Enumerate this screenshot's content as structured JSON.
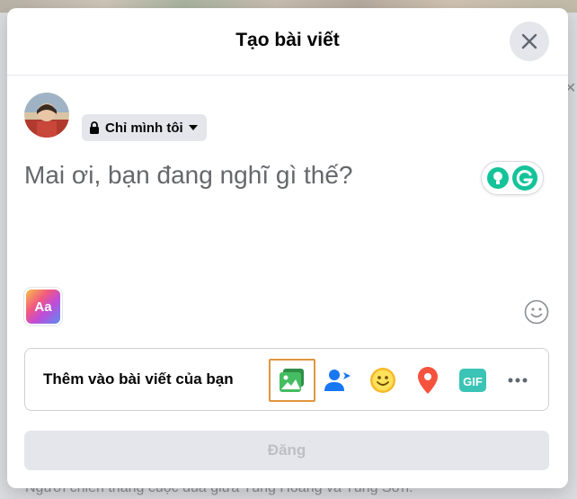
{
  "background": {
    "caption_text": "Người chiến thắng cuộc đua giữa Tùng Hoàng và Tùng Sơn."
  },
  "header": {
    "title": "Tạo bài viết",
    "close_icon": "close-icon"
  },
  "user": {
    "avatar_icon": "avatar-photo"
  },
  "privacy": {
    "label": "Chỉ mình tôi",
    "icon": "lock-icon"
  },
  "composer": {
    "placeholder": "Mai ơi, bạn đang nghĩ gì thế?"
  },
  "text_format": {
    "label": "Aa"
  },
  "add_to_post": {
    "label": "Thêm vào bài viết của bạn",
    "tools": [
      {
        "icon": "photo-video-icon",
        "color": "#45bd62"
      },
      {
        "icon": "tag-people-icon",
        "color": "#1877f2"
      },
      {
        "icon": "feeling-icon",
        "color": "#f7b928"
      },
      {
        "icon": "check-in-icon",
        "color": "#f5533d"
      },
      {
        "icon": "gif-icon",
        "color": "#3bc4b5",
        "label": "GIF"
      },
      {
        "icon": "more-icon",
        "color": "#606770"
      }
    ]
  },
  "post_button": {
    "label": "Đăng"
  },
  "colors": {
    "accent": "#1877f2",
    "highlight_border": "#e0963e"
  }
}
